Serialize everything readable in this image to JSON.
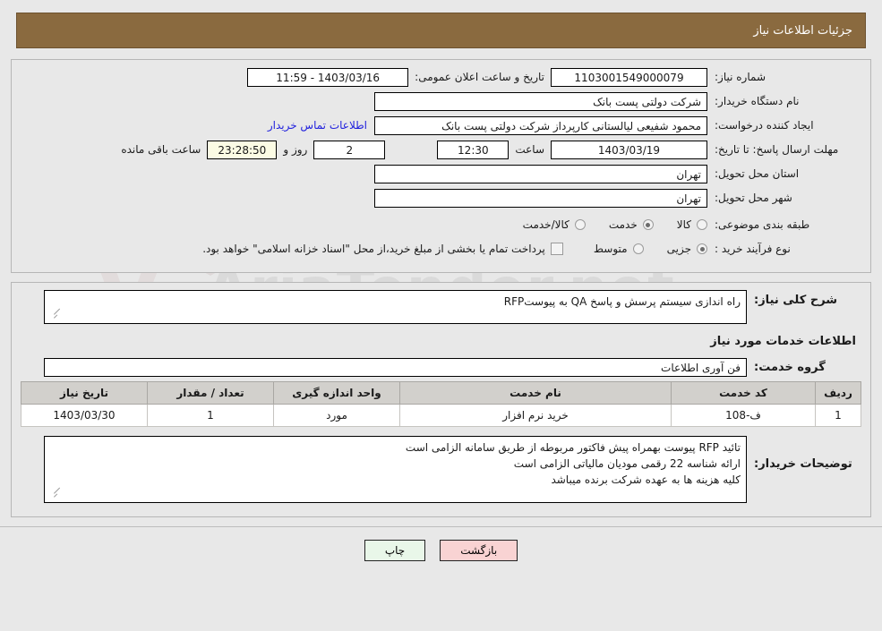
{
  "header": {
    "title": "جزئیات اطلاعات نیاز",
    "bar_color": "#8a6a3f"
  },
  "summary": {
    "need_number_label": "شماره نیاز:",
    "need_number_value": "1103001549000079",
    "announce_label": "تاریخ و ساعت اعلان عمومی:",
    "announce_value": "1403/03/16 - 11:59",
    "buyer_org_label": "نام دستگاه خریدار:",
    "buyer_org_value": "شرکت دولتی پست بانک",
    "requester_label": "ایجاد کننده درخواست:",
    "requester_value": "محمود شفیعی لیالستانی کارپرداز شرکت دولتی پست بانک",
    "contact_link": "اطلاعات تماس خریدار",
    "deadline_label": "مهلت ارسال پاسخ: تا تاریخ:",
    "deadline_date": "1403/03/19",
    "hour_label": "ساعت",
    "deadline_time": "12:30",
    "days_remaining": "2",
    "days_label": "روز و",
    "clock_remaining": "23:28:50",
    "remaining_label": "ساعت باقی مانده",
    "province_label": "استان محل تحویل:",
    "province_value": "تهران",
    "city_label": "شهر محل تحویل:",
    "city_value": "تهران",
    "category_label": "طبقه بندی موضوعی:",
    "category_options": [
      {
        "label": "کالا",
        "selected": false
      },
      {
        "label": "خدمت",
        "selected": true
      },
      {
        "label": "کالا/خدمت",
        "selected": false
      }
    ],
    "process_label": "نوع فرآیند خرید :",
    "process_options": [
      {
        "label": "جزیی",
        "selected": true
      },
      {
        "label": "متوسط",
        "selected": false
      }
    ],
    "treasury_checkbox_checked": false,
    "treasury_note": "پرداخت تمام یا بخشی از مبلغ خرید،از محل \"اسناد خزانه اسلامی\" خواهد بود."
  },
  "description": {
    "label": "شرح کلی نیاز:",
    "value": "راه اندازی سیستم پرسش و پاسخ QA به پیوستRFP"
  },
  "services": {
    "heading": "اطلاعات خدمات مورد نیاز",
    "group_label": "گروه خدمت:",
    "group_value": "فن آوری اطلاعات",
    "columns": [
      "ردیف",
      "کد خدمت",
      "نام خدمت",
      "واحد اندازه گیری",
      "تعداد / مقدار",
      "تاریخ نیاز"
    ],
    "rows": [
      {
        "row": "1",
        "code": "ف-108",
        "name": "خرید نرم افزار",
        "unit": "مورد",
        "qty": "1",
        "date": "1403/03/30"
      }
    ]
  },
  "buyer_notes": {
    "label": "توضیحات خریدار:",
    "lines": [
      "تائید RFP پیوست بهمراه پیش فاکتور مربوطه از طریق سامانه الزامی است",
      "ارائه شناسه 22 رقمی مودیان مالیاتی الزامی است",
      "کلیه هزینه ها به عهده شرکت برنده میباشد"
    ]
  },
  "footer": {
    "print_label": "چاپ",
    "back_label": "بازگشت"
  },
  "watermark": {
    "text": "AriaTender.net"
  }
}
